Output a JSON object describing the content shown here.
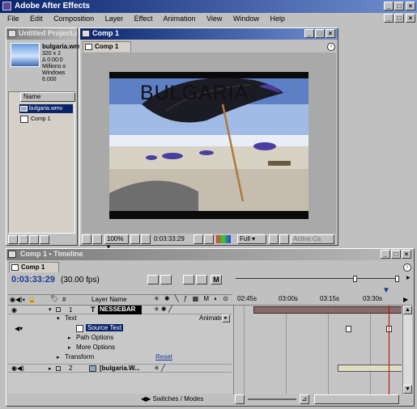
{
  "app": {
    "title": "Adobe After Effects"
  },
  "menu": [
    "File",
    "Edit",
    "Composition",
    "Layer",
    "Effect",
    "Animation",
    "View",
    "Window",
    "Help"
  ],
  "project": {
    "title": "Untitled Project.aep",
    "file": "bulgaria.wmv",
    "meta": [
      "320 x 2",
      "Δ 0:00:0",
      "Millions o",
      "Windows",
      "6.000"
    ],
    "col_name": "Name",
    "items": [
      "bulgaria.wmv",
      "Comp 1"
    ]
  },
  "comp": {
    "title": "Comp 1",
    "tab": "Comp 1",
    "overlay": "BULGARIA",
    "zoom": "100%",
    "time": "0:03:33:29",
    "res": "Full",
    "active_cam": "Active Ca"
  },
  "timeline": {
    "title": "Comp 1 • Timeline",
    "tab": "Comp 1",
    "timecode": "0:03:33:29",
    "fps": "(30.00 fps)",
    "col_layer": "Layer Name",
    "col_num": "#",
    "ruler": [
      "02:45s",
      "03:00s",
      "03:15s",
      "03:30s"
    ],
    "rows": [
      {
        "num": "1",
        "name": "NESSEBAR",
        "type": "T"
      },
      {
        "label": "Text",
        "animate": "Animate:"
      },
      {
        "label": "Source Text"
      },
      {
        "label": "Path Options"
      },
      {
        "label": "More Options"
      },
      {
        "label": "Transform",
        "reset": "Reset"
      },
      {
        "num": "2",
        "name": "[bulgaria.W..."
      }
    ],
    "footer": "Switches / Modes"
  },
  "colors": {
    "title_active": "#0a246a",
    "playhead": "#cc0000",
    "layer_bar": "#8a6a6a"
  }
}
